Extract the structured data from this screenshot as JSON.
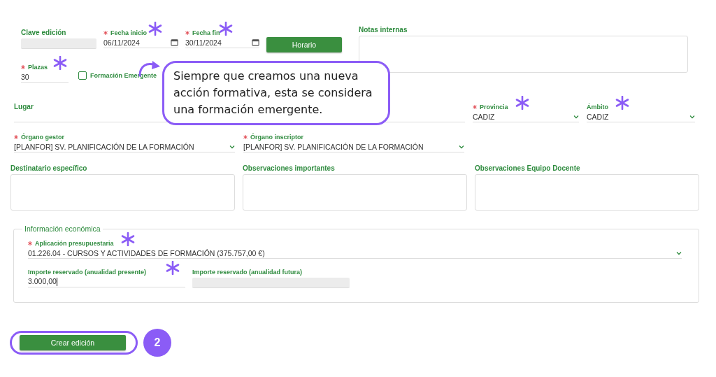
{
  "top_fields": [
    {
      "kind": "readonly",
      "label": "Clave edición"
    },
    {
      "kind": "date",
      "label": "Fecha inicio",
      "value": "06/11/2024",
      "required": true,
      "flagged": true
    },
    {
      "kind": "date",
      "label": "Fecha fin",
      "value": "30/11/2024",
      "required": true,
      "flagged": true
    }
  ],
  "schedule_button": "Horario",
  "internal_notes": {
    "kind": "textarea",
    "label": "Notas internas"
  },
  "seats": {
    "kind": "text",
    "label": "Plazas",
    "value": "30",
    "required": true,
    "flagged": true
  },
  "emergent": {
    "label": "Formación Emergente",
    "checked": false
  },
  "location_fields": [
    {
      "kind": "text",
      "label": "Lugar"
    },
    {
      "kind": "select",
      "label": "Provincia",
      "value": "CADIZ",
      "required": true,
      "flagged": true
    },
    {
      "kind": "select",
      "label": "Ámbito",
      "value": "CADIZ",
      "flagged": true
    }
  ],
  "organ_fields": [
    {
      "kind": "select",
      "label": "Órgano gestor",
      "value": "[PLANFOR] SV. PLANIFICACIÓN DE LA FORMACIÓN",
      "required": true
    },
    {
      "kind": "select",
      "label": "Órgano inscriptor",
      "value": "[PLANFOR] SV. PLANIFICACIÓN DE LA FORMACIÓN",
      "required": true
    }
  ],
  "notes_fields": [
    {
      "kind": "textarea",
      "label": "Destinatario específico"
    },
    {
      "kind": "textarea",
      "label": "Observaciones importantes"
    },
    {
      "kind": "textarea",
      "label": "Observaciones Equipo Docente"
    }
  ],
  "economic": {
    "legend": "Información económica",
    "budget": {
      "kind": "select",
      "label": "Aplicación presupuestaria",
      "value": "01.226.04 - CURSOS Y ACTIVIDADES DE FORMACIÓN (375.757,00 €)",
      "required": true,
      "flagged": true
    },
    "amounts": [
      {
        "kind": "text",
        "label": "Importe reservado (anualidad presente)",
        "value": "3.000,00",
        "flagged": true,
        "focused": true
      },
      {
        "kind": "readonly",
        "label": "Importe reservado (anualidad futura)"
      }
    ]
  },
  "submit": {
    "label": "Crear edición",
    "highlighted": true
  },
  "step_badge": "2",
  "callout": {
    "text": "Siempre que creamos una nueva acción formativa, esta se considera una formación emergente."
  }
}
